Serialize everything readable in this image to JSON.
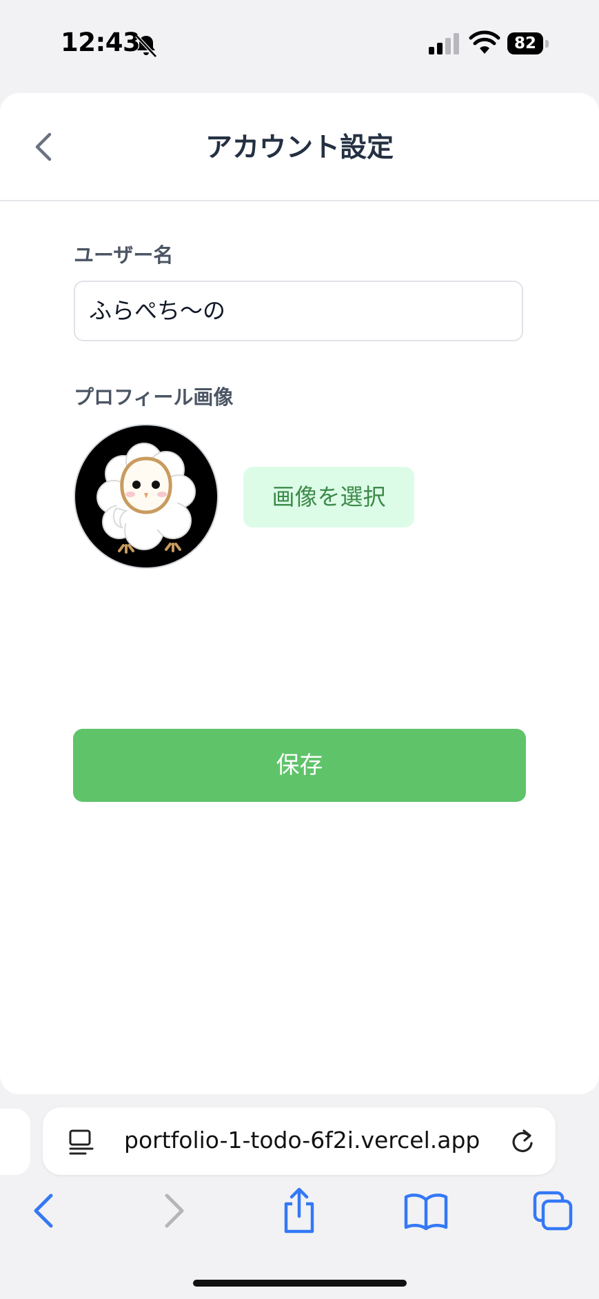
{
  "status_bar": {
    "time": "12:43",
    "battery": "82"
  },
  "header": {
    "title": "アカウント設定"
  },
  "form": {
    "username_label": "ユーザー名",
    "username_value": "ふらぺち〜の",
    "profile_image_label": "プロフィール画像",
    "select_image_label": "画像を選択",
    "save_label": "保存"
  },
  "browser": {
    "url": "portfolio-1-todo-6f2i.vercel.app"
  },
  "colors": {
    "accent": "#5fc36a",
    "secondary_bg": "#dcfce7",
    "secondary_text": "#3d8a4a"
  },
  "icons": {
    "back": "chevron-left-icon",
    "bell": "bell-slash-icon",
    "signal": "cellular-signal-icon",
    "wifi": "wifi-icon",
    "reader": "reader-icon",
    "reload": "reload-icon",
    "share": "share-icon",
    "bookmarks": "book-icon",
    "tabs": "tabs-icon"
  }
}
